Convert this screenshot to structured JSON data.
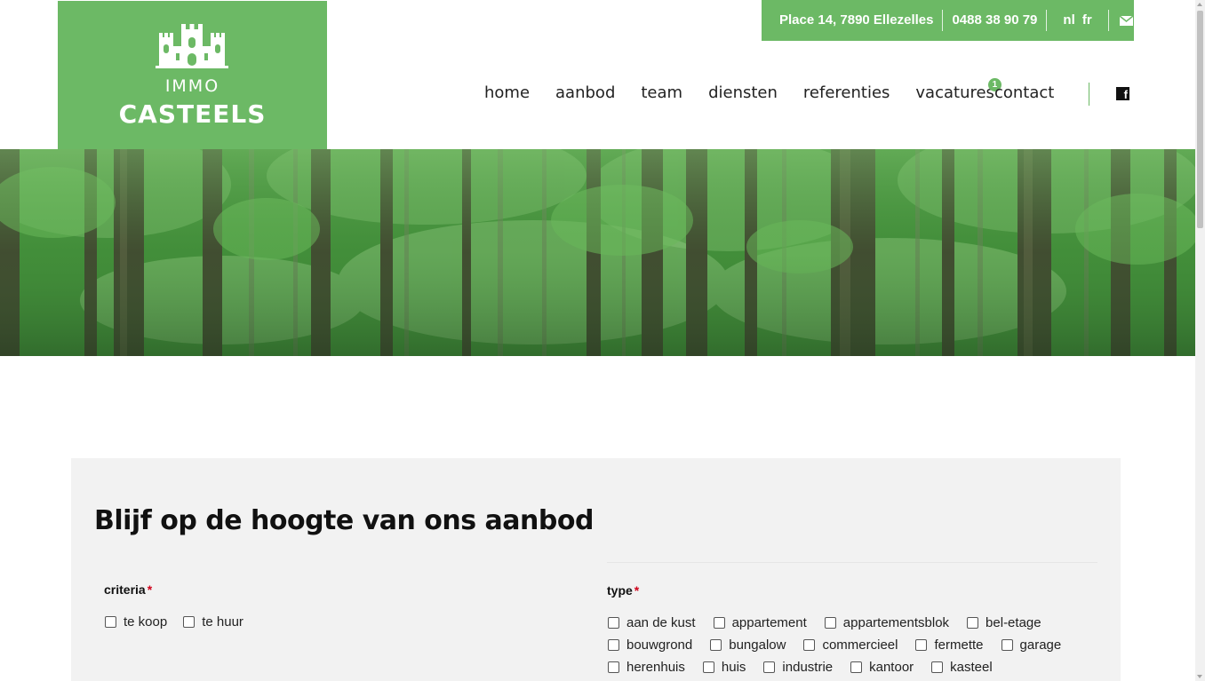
{
  "logo": {
    "line1": "IMMO",
    "line2": "CASTEELS"
  },
  "topbar": {
    "address": "Place 14, 7890 Ellezelles",
    "phone": "0488 38 90 79",
    "lang_nl": "nl",
    "lang_fr": "fr",
    "mail_icon": "envelope-icon"
  },
  "nav": {
    "items": [
      "home",
      "aanbod",
      "team",
      "diensten",
      "referenties",
      "vacatures",
      "contact"
    ],
    "vacatures_badge": "1",
    "social_icon": "facebook-icon"
  },
  "hero": {
    "image": "forest-banner"
  },
  "form": {
    "title": "Blijf op de hoogte van ons aanbod",
    "criteria_label": "criteria",
    "required_mark": "*",
    "criteria_options": [
      "te koop",
      "te huur"
    ],
    "type_label": "type",
    "type_rows": [
      [
        "aan de kust",
        "appartement",
        "appartementsblok",
        "bel-etage"
      ],
      [
        "bouwgrond",
        "bungalow",
        "commercieel",
        "fermette",
        "garage"
      ],
      [
        "herenhuis",
        "huis",
        "industrie",
        "kantoor",
        "kasteel"
      ]
    ]
  },
  "colors": {
    "brand_green": "#6cb965",
    "panel_bg": "#f2f2f2",
    "required_red": "#d0021b"
  }
}
